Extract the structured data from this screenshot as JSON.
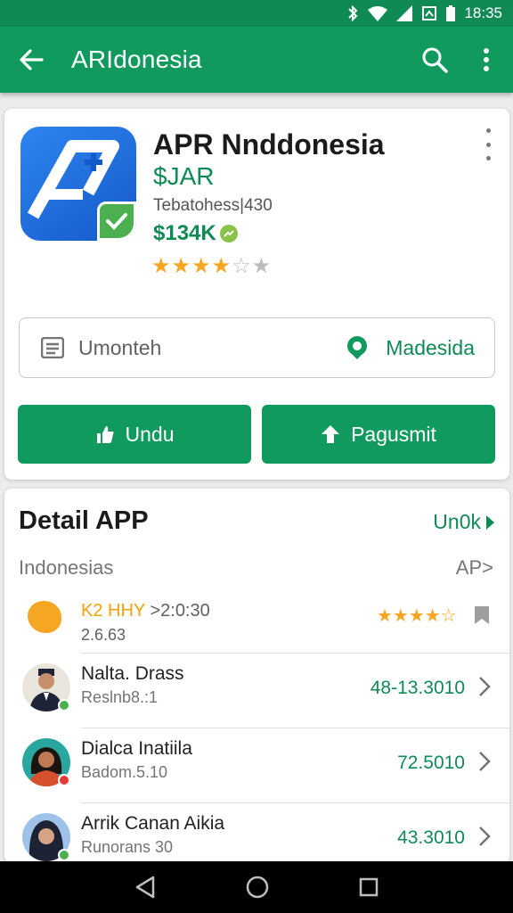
{
  "status_bar": {
    "time": "18:35"
  },
  "app_bar": {
    "title": "ARIdonesia"
  },
  "app": {
    "name": "APR Nnddonesia",
    "price": "$JAR",
    "subtitle": "Tebatohess|430",
    "downloads": "$134K",
    "rating": 3.5,
    "stars": [
      {
        "char": "★",
        "state": "on"
      },
      {
        "char": "★",
        "state": "on"
      },
      {
        "char": "★",
        "state": "on"
      },
      {
        "char": "★",
        "state": "on"
      },
      {
        "char": "☆",
        "state": "off"
      },
      {
        "char": "★",
        "state": "off"
      }
    ],
    "info_left": "Umonteh",
    "info_right": "Madesida",
    "install_label": "Undu",
    "open_label": "Pagusmit",
    "accent_color": "#109a5e"
  },
  "details": {
    "title": "Detail APP",
    "more_label": "Un0k",
    "subheader_left": "Indonesias",
    "subheader_right": "AP>",
    "featured": {
      "title_orange": "K2 HHY",
      "title_grey": ">2:0:30",
      "subtitle": "2.6.63",
      "stars": "★★★★☆"
    },
    "rows": [
      {
        "name": "Nalta. Drass",
        "subtitle": "Reslnb8.:1",
        "value": "48-13.3010"
      },
      {
        "name": "Dialca Inatiila",
        "subtitle": "Badom.5.10",
        "value": "72.5010"
      },
      {
        "name": "Arrik Canan Aikia",
        "subtitle": "Runorans 30",
        "value": "43.3010"
      }
    ]
  },
  "icons": [
    "back-arrow-icon",
    "search-icon",
    "more-vert-icon",
    "document-icon",
    "location-pin-icon",
    "thumbs-up-icon",
    "upload-icon",
    "chevron-right-icon"
  ]
}
